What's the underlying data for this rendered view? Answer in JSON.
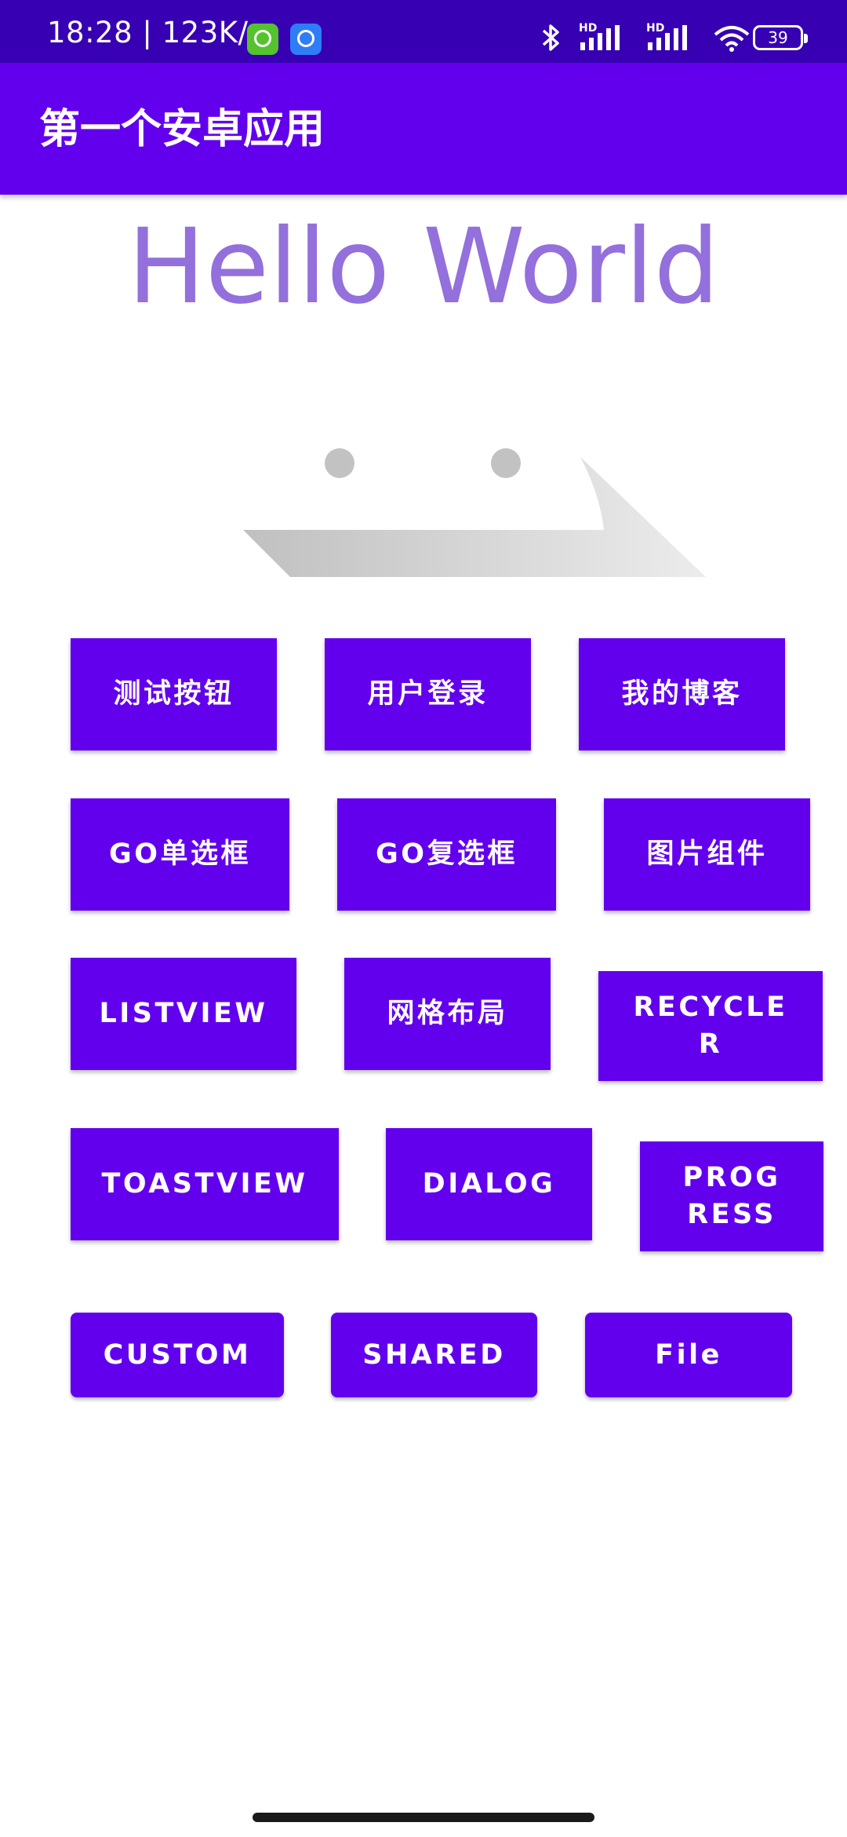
{
  "status_bar": {
    "time_speed": "18:28 | 123K/s",
    "hd_label": "HD",
    "battery": "39",
    "icons": [
      "bluetooth-icon",
      "signal-icon",
      "wifi-icon",
      "battery-icon"
    ]
  },
  "toolbar": {
    "title": "第一个安卓应用"
  },
  "main": {
    "hello_text": "Hello World"
  },
  "buttons": {
    "row1": [
      "测试按钮",
      "用户登录",
      "我的博客"
    ],
    "row2": [
      "GO单选框",
      "GO复选框",
      "图片组件"
    ],
    "row3": [
      "LISTVIEW",
      "网格布局",
      "RECYCLER"
    ],
    "row4": [
      "TOASTVIEW",
      "DIALOG",
      "PROGRESS"
    ],
    "row5": [
      "CUSTOM",
      "SHARED",
      "File"
    ]
  },
  "colors": {
    "status_bar": "#3700b3",
    "primary": "#6200ee",
    "hello_text": "#9370db"
  }
}
